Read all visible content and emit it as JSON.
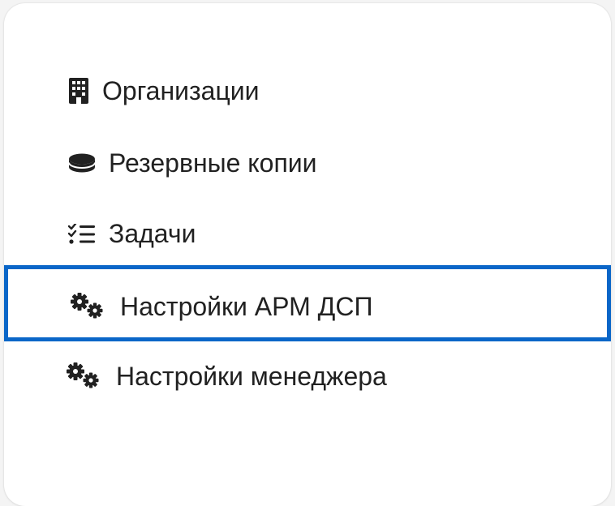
{
  "menu": {
    "items": [
      {
        "label": "Организации",
        "icon": "building-icon",
        "selected": false
      },
      {
        "label": "Резервные копии",
        "icon": "database-icon",
        "selected": false
      },
      {
        "label": "Задачи",
        "icon": "tasks-list-icon",
        "selected": false
      },
      {
        "label": "Настройки АРМ ДСП",
        "icon": "gears-icon",
        "selected": true
      },
      {
        "label": "Настройки менеджера",
        "icon": "gears-icon",
        "selected": false
      }
    ]
  },
  "colors": {
    "accent_border": "#0a66c8",
    "text": "#212121",
    "panel_background": "#ffffff"
  }
}
